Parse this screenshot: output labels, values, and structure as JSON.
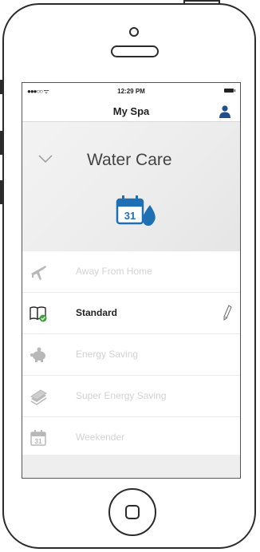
{
  "status_bar": {
    "signal": "●●●○○ ᯤ",
    "time": "12:29 PM"
  },
  "nav": {
    "title": "My Spa"
  },
  "section": {
    "title": "Water Care",
    "calendar_day": "31"
  },
  "modes": [
    {
      "label": "Away From Home",
      "icon": "airplane-icon",
      "active": false
    },
    {
      "label": "Standard",
      "icon": "book-check-icon",
      "active": true
    },
    {
      "label": "Energy Saving",
      "icon": "piggy-bank-icon",
      "active": false
    },
    {
      "label": "Super Energy Saving",
      "icon": "money-stack-icon",
      "active": false
    },
    {
      "label": "Weekender",
      "icon": "calendar-icon",
      "active": false,
      "calendar_day": "31"
    }
  ],
  "colors": {
    "accent_blue": "#1f6fb5",
    "check_green": "#3aa53a",
    "inactive_text": "#d2d2d2"
  }
}
